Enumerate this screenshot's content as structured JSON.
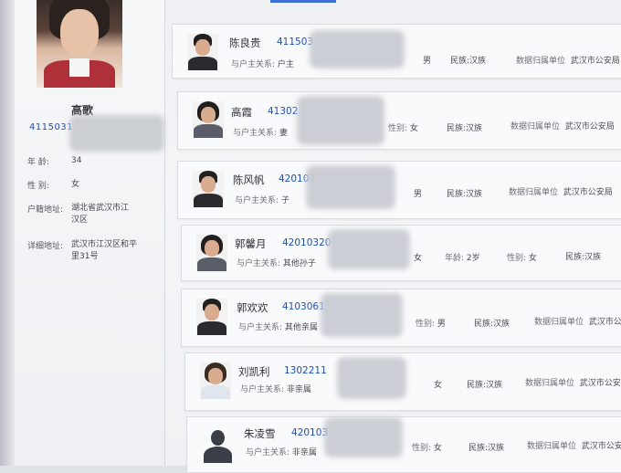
{
  "profile": {
    "name": "高歌",
    "id_number": "4115031",
    "age_label": "年    龄:",
    "age_value": "34",
    "gender_label": "性    别:",
    "gender_value": "女",
    "household_label": "户籍地址:",
    "household_value": "湖北省武汉市江汉区",
    "address_label": "详细地址:",
    "address_value": "武汉市江汉区和平里31号"
  },
  "members": [
    {
      "name": "陈良贵",
      "id": "411503",
      "relation_label": "与户主关系:",
      "relation": "户主",
      "age_text": "",
      "gender_label": "",
      "gender": "男",
      "ethnicity": "民族:汉族",
      "source_label": "数据归属单位",
      "source": "武汉市公安局"
    },
    {
      "name": "高霞",
      "id": "41302",
      "relation_label": "与户主关系:",
      "relation": "妻",
      "age_text": "",
      "gender_label": "性别:",
      "gender": "女",
      "ethnicity": "民族:汉族",
      "source_label": "数据归属单位",
      "source": "武汉市公安局"
    },
    {
      "name": "陈风帆",
      "id": "420107",
      "relation_label": "与户主关系:",
      "relation": "子",
      "age_text": "",
      "gender_label": "",
      "gender": "男",
      "ethnicity": "民族:汉族",
      "source_label": "数据归属单位",
      "source": "武汉市公安局"
    },
    {
      "name": "郭馨月",
      "id": "42010320",
      "relation_label": "与户主关系:",
      "relation": "其他孙子",
      "age_text": "女",
      "age_label": "年龄:",
      "age_value": "2岁",
      "gender_label": "性别:",
      "gender": "女",
      "ethnicity": "民族:汉族",
      "source_label": "",
      "source": ""
    },
    {
      "name": "郭欢欢",
      "id": "4103061",
      "relation_label": "与户主关系:",
      "relation": "其他亲属",
      "age_text": "",
      "gender_label": "性别:",
      "gender": "男",
      "ethnicity": "民族:汉族",
      "source_label": "数据归属单位",
      "source": "武汉市公安"
    },
    {
      "name": "刘凯利",
      "id": "1302211",
      "relation_label": "与户主关系:",
      "relation": "非亲属",
      "age_text": "",
      "gender_label": "",
      "gender": "女",
      "ethnicity": "民族:汉族",
      "source_label": "数据归属单位",
      "source": "武汉市公安"
    },
    {
      "name": "朱凌雪",
      "id": "420103",
      "relation_label": "与户主关系:",
      "relation": "非亲属",
      "age_text": "",
      "gender_label": "性别:",
      "gender": "女",
      "ethnicity": "民族:汉族",
      "source_label": "数据归属单位",
      "source": "武汉市公安"
    }
  ]
}
